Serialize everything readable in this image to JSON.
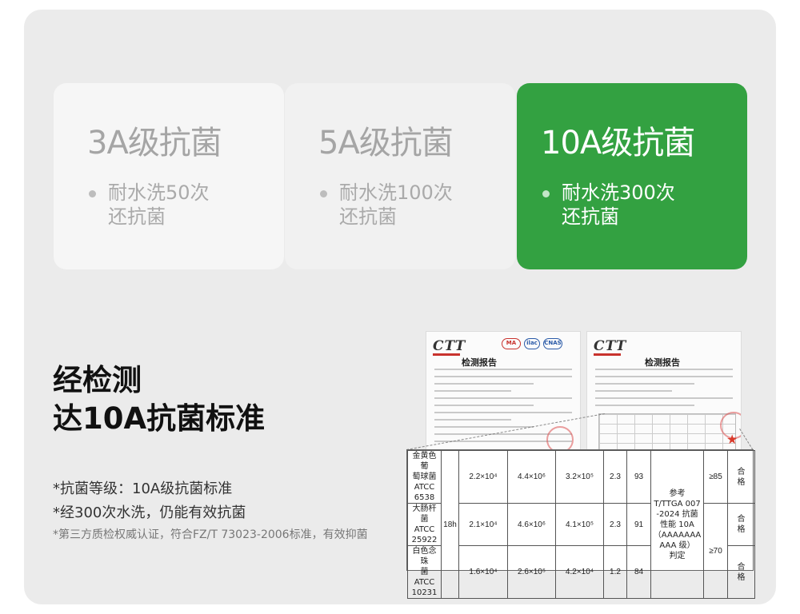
{
  "cards": [
    {
      "title": "3A级抗菌",
      "desc_lines": [
        "耐水洗50次",
        "还抗菌"
      ]
    },
    {
      "title": "5A级抗菌",
      "desc_lines": [
        "耐水洗100次",
        "还抗菌"
      ]
    },
    {
      "title": "10A级抗菌",
      "desc_lines": [
        "耐水洗300次",
        "还抗菌"
      ],
      "highlighted": true
    }
  ],
  "colors": {
    "highlight_green": "#33a141",
    "panel_gray": "#ebebeb",
    "accent_red": "#c8322d"
  },
  "headline": {
    "line1": "经检测",
    "line2": "达10A抗菌标准"
  },
  "notes": {
    "note1": "*抗菌等级：10A级抗菌标准",
    "note2": "*经300次水洗，仍能有效抗菌",
    "note3": "*第三方质检权威认证，符合FZ/T 73023-2006标准，有效抑菌"
  },
  "reports": [
    {
      "logo": "CTT",
      "title": "检测报告",
      "cert_marks": [
        "MA",
        "ilac",
        "CNAS"
      ]
    },
    {
      "logo": "CTT",
      "title": "检测报告"
    }
  ],
  "result_table": {
    "time": "18h",
    "rows": [
      {
        "organism_lines": [
          "金黄色葡",
          "萄球菌",
          "ATCC",
          "6538"
        ],
        "v1": "2.2×10⁴",
        "v2": "4.4×10⁶",
        "v3": "3.2×10⁵",
        "v4": "2.3",
        "v5": "93",
        "standard_lines": [
          "参考",
          "T/TTGA 007",
          "-2024 抗菌",
          "性能 10A",
          "（AAAAAAA",
          "AAA 级）",
          "判定"
        ],
        "threshold": "≥85",
        "judge": [
          "合",
          "格"
        ]
      },
      {
        "organism_lines": [
          "大肠杆菌",
          "ATCC",
          "25922"
        ],
        "v1": "2.1×10⁴",
        "v2": "4.6×10⁶",
        "v3": "4.1×10⁵",
        "v4": "2.3",
        "v5": "91",
        "judge": [
          "合",
          "格"
        ]
      },
      {
        "organism_lines": [
          "白色念珠",
          "菌",
          "ATCC",
          "10231"
        ],
        "v1": "1.6×10⁴",
        "v2": "2.6×10⁵",
        "v3": "4.2×10⁴",
        "v4": "1.2",
        "v5": "84",
        "threshold": "≥70",
        "judge": [
          "合",
          "格"
        ]
      }
    ]
  }
}
